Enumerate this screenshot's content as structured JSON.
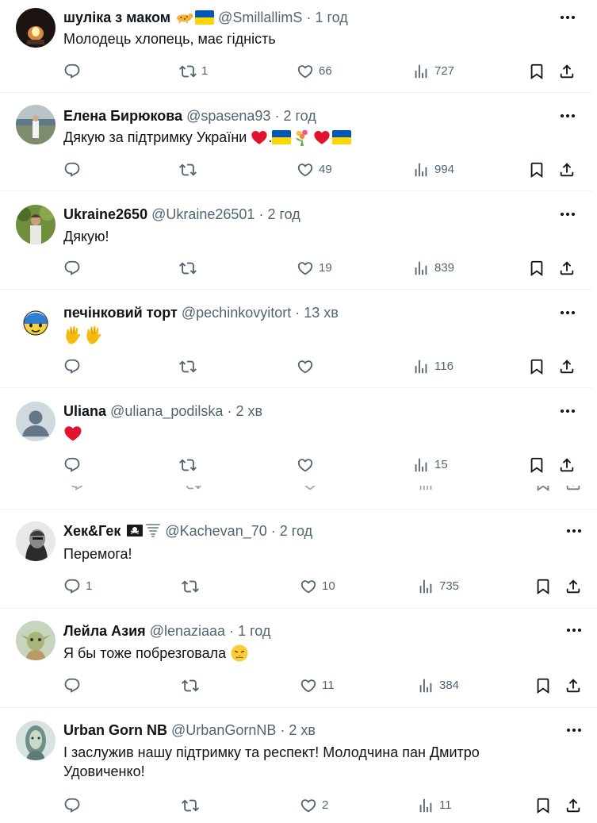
{
  "tweets": [
    {
      "name": "шуліка з маком",
      "handle": "@SmillallimS",
      "sep": "·",
      "time": "1 год",
      "text": "Молодець хлопець, має гідність",
      "replies": "",
      "reposts": "1",
      "likes": "66",
      "views": "727",
      "name_emoji": [
        "leopard-emoji",
        "ukraine-flag-emoji"
      ]
    },
    {
      "name": "Елена Бирюкова",
      "handle": "@spasena93",
      "sep": "·",
      "time": "2 год",
      "text": "Дякую за підтримку України",
      "replies": "",
      "reposts": "",
      "likes": "49",
      "views": "994",
      "text_emoji": [
        "red-heart-emoji",
        "dot",
        "ukraine-flag-emoji",
        "bouquet-emoji",
        "red-heart-emoji",
        "ukraine-flag-emoji"
      ]
    },
    {
      "name": "Ukraine2650",
      "handle": "@Ukraine26501",
      "sep": "·",
      "time": "2 год",
      "text": "Дякую!",
      "replies": "",
      "reposts": "",
      "likes": "19",
      "views": "839"
    },
    {
      "name": "печінковий торт",
      "handle": "@pechinkovyitort",
      "sep": "·",
      "time": "13 хв",
      "text": "",
      "replies": "",
      "reposts": "",
      "likes": "",
      "views": "116",
      "text_emoji": [
        "clapping-hands-emoji",
        "clapping-hands-emoji"
      ]
    },
    {
      "name": "Uliana",
      "handle": "@uliana_podilska",
      "sep": "·",
      "time": "2 хв",
      "text": "",
      "replies": "",
      "reposts": "",
      "likes": "",
      "views": "15",
      "text_emoji": [
        "red-heart-emoji"
      ]
    },
    {
      "name": "Хек&Гек",
      "handle": "@Kachevan_70",
      "sep": "·",
      "time": "2 год",
      "text": "Перемога!",
      "replies": "1",
      "reposts": "",
      "likes": "10",
      "views": "735",
      "name_emoji": [
        "pirate-flag-emoji",
        "tornado-emoji"
      ]
    },
    {
      "name": "Лейла Азия",
      "handle": "@lenaziaaa",
      "sep": "·",
      "time": "1 год",
      "text": "Я бы тоже побрезговала",
      "replies": "",
      "reposts": "",
      "likes": "11",
      "views": "384",
      "text_emoji": [
        "weary-face-emoji"
      ]
    },
    {
      "name": "Urban Gorn NB",
      "handle": "@UrbanGornNB",
      "sep": "·",
      "time": "2 хв",
      "text": "І заслужив нашу підтримку та респект! Молодчина пан Дмитро Удовиченко!",
      "replies": "",
      "reposts": "",
      "likes": "2",
      "views": "11"
    }
  ],
  "colors": {
    "text": "#0f1419",
    "secondary": "#536471",
    "divider": "#eff3f4",
    "heart_red": "#e0142d",
    "flag_blue": "#0057b7",
    "flag_yellow": "#ffd700"
  }
}
